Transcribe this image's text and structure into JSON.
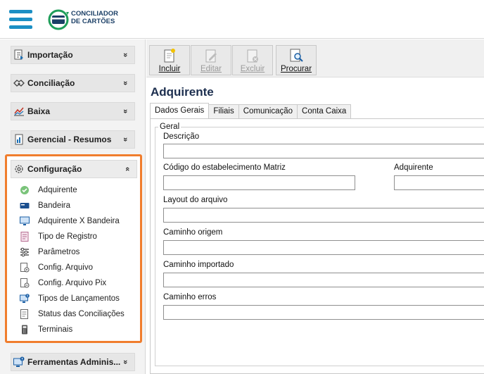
{
  "header": {
    "logo_line1": "CONCILIADOR",
    "logo_line2": "DE CARTÕES",
    "accent_color": "#1b8fc4"
  },
  "sidebar": {
    "menus": [
      {
        "label": "Importação",
        "icon": "import-icon",
        "chevron": "»"
      },
      {
        "label": "Conciliação",
        "icon": "handshake-icon",
        "chevron": "»"
      },
      {
        "label": "Baixa",
        "icon": "chart-down-icon",
        "chevron": "»"
      },
      {
        "label": "Gerencial - Resumos",
        "icon": "report-icon",
        "chevron": "»"
      },
      {
        "label": "Configuração",
        "icon": "gear-icon",
        "chevron": "«",
        "expanded": true
      },
      {
        "label": "Ferramentas Adminis...",
        "icon": "admin-tools-icon",
        "chevron": "»"
      }
    ],
    "config_items": [
      {
        "label": "Adquirente",
        "icon": "check-circle-icon"
      },
      {
        "label": "Bandeira",
        "icon": "card-flag-icon"
      },
      {
        "label": "Adquirente X Bandeira",
        "icon": "monitor-icon"
      },
      {
        "label": "Tipo de Registro",
        "icon": "document-icon"
      },
      {
        "label": "Parâmetros",
        "icon": "sliders-icon"
      },
      {
        "label": "Config. Arquivo",
        "icon": "file-config-icon"
      },
      {
        "label": "Config. Arquivo Pix",
        "icon": "file-pix-icon"
      },
      {
        "label": "Tipos de Lançamentos",
        "icon": "monitor-alert-icon"
      },
      {
        "label": "Status das Conciliações",
        "icon": "status-icon"
      },
      {
        "label": "Terminais",
        "icon": "pos-terminal-icon"
      }
    ],
    "highlight_color": "#f07d2d"
  },
  "toolbar": {
    "incluir": "Incluir",
    "editar": "Editar",
    "excluir": "Excluir",
    "procurar": "Procurar"
  },
  "main": {
    "title": "Adquirente",
    "tabs": [
      "Dados Gerais",
      "Filiais",
      "Comunicação",
      "Conta Caixa"
    ],
    "active_tab": "Dados Gerais",
    "group_label": "Geral",
    "fields": {
      "descricao": {
        "label": "Descrição",
        "value": ""
      },
      "codigo": {
        "label": "Código do estabelecimento Matriz",
        "value": ""
      },
      "adquirente": {
        "label": "Adquirente",
        "value": ""
      },
      "layout": {
        "label": "Layout do arquivo",
        "value": ""
      },
      "origem": {
        "label": "Caminho origem",
        "value": ""
      },
      "importado": {
        "label": "Caminho importado",
        "value": ""
      },
      "erros": {
        "label": "Caminho erros",
        "value": ""
      }
    }
  }
}
